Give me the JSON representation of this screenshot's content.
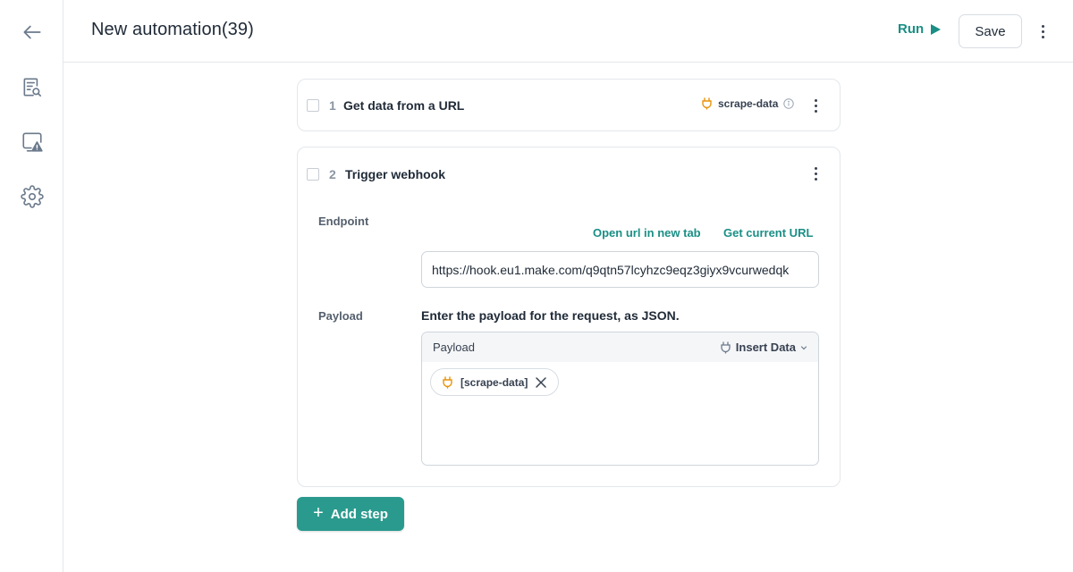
{
  "header": {
    "title": "New automation(39)",
    "run_label": "Run",
    "save_label": "Save"
  },
  "sidebar": {
    "items": [
      {
        "icon": "arrow-left-icon"
      },
      {
        "icon": "report-search-icon"
      },
      {
        "icon": "warning-monitor-icon"
      },
      {
        "icon": "gear-icon"
      }
    ]
  },
  "steps": [
    {
      "number": "1",
      "title": "Get data from a URL",
      "output_variable": "scrape-data"
    },
    {
      "number": "2",
      "title": "Trigger webhook",
      "endpoint_label": "Endpoint",
      "open_url_link": "Open url in new tab",
      "get_current_url_link": "Get current URL",
      "endpoint_value": "https://hook.eu1.make.com/q9qtn57lcyhzc9eqz3giyx9vcurwedqk",
      "payload_label": "Payload",
      "payload_hint": "Enter the payload for the request, as JSON.",
      "payload_box_label": "Payload",
      "insert_data_label": "Insert Data",
      "payload_chip": "[scrape-data]"
    }
  ],
  "add_step_label": "Add step",
  "colors": {
    "accent": "#1a8f86",
    "button_bg": "#2a9a8e",
    "variable_icon": "#e8930c"
  }
}
